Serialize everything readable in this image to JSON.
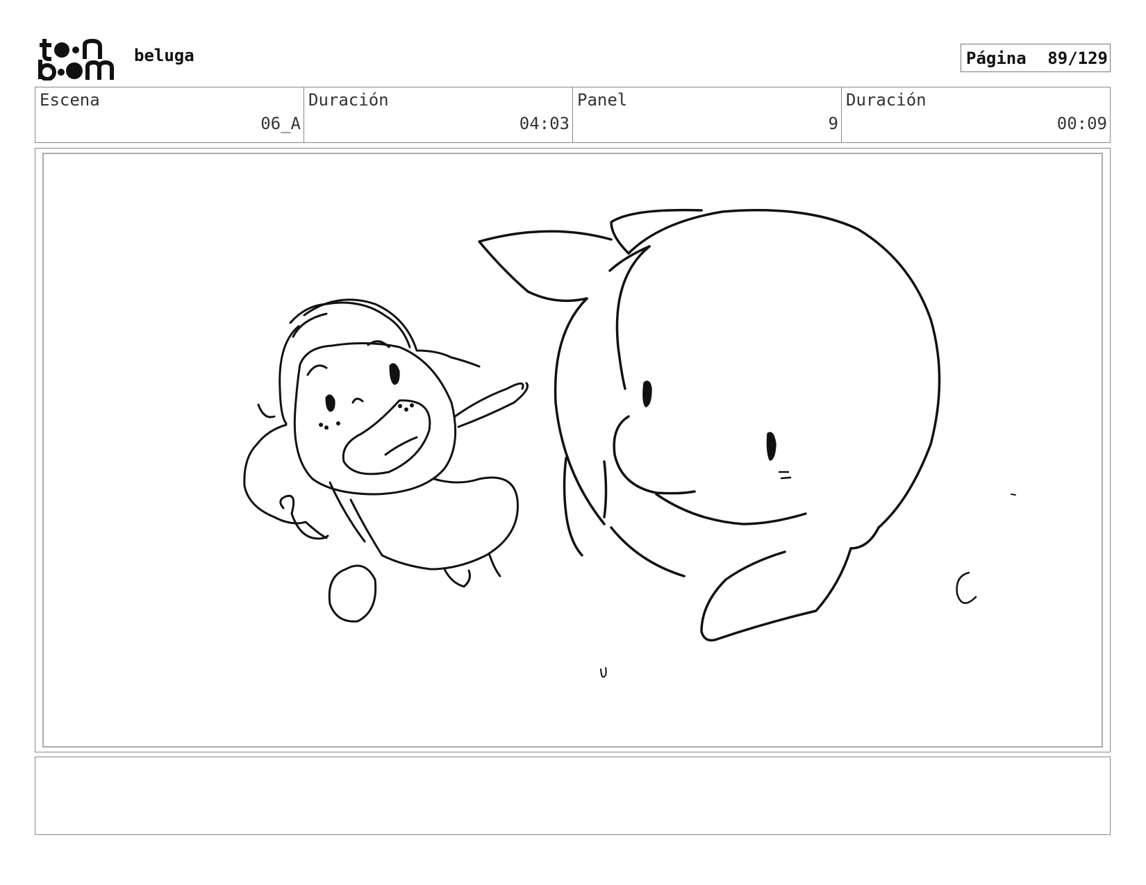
{
  "header": {
    "logo_text": "toon boom",
    "project_title": "beluga",
    "page_label": "Página",
    "page_number": "89/129"
  },
  "info": {
    "scene_label": "Escena",
    "scene_value": "06_A",
    "scene_duration_label": "Duración",
    "scene_duration_value": "04:03",
    "panel_label": "Panel",
    "panel_value": "9",
    "panel_duration_label": "Duración",
    "panel_duration_value": "00:09"
  },
  "notes": {
    "text": ""
  }
}
